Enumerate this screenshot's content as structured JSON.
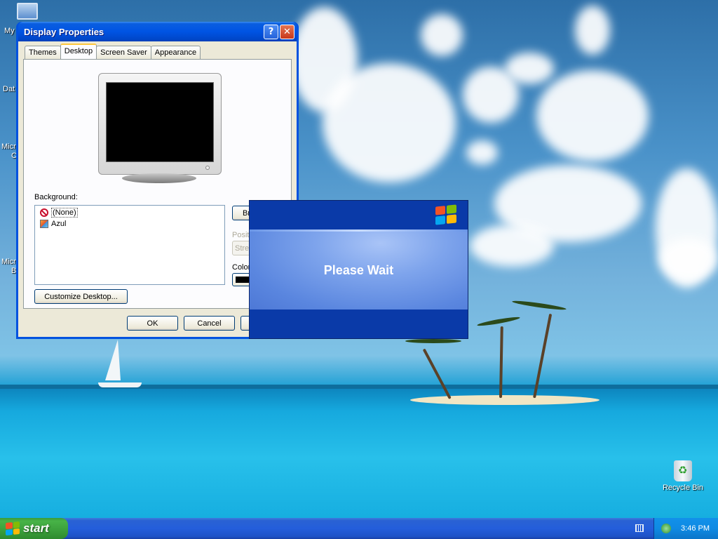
{
  "desktop": {
    "icons": [
      {
        "label": "My"
      },
      {
        "label": "Dat"
      },
      {
        "label": "Micro"
      },
      {
        "label": "C"
      },
      {
        "label": "Micro"
      },
      {
        "label": "B"
      }
    ],
    "recycle_bin": {
      "label": "Recycle Bin"
    }
  },
  "display_properties": {
    "title": "Display Properties",
    "help_glyph": "?",
    "close_glyph": "✕",
    "tabs": [
      {
        "label": "Themes"
      },
      {
        "label": "Desktop",
        "active": true
      },
      {
        "label": "Screen Saver"
      },
      {
        "label": "Appearance"
      }
    ],
    "background_label": "Background:",
    "backgrounds": [
      {
        "label": "(None)",
        "icon": "none-icon",
        "selected": true
      },
      {
        "label": "Azul",
        "icon": "image-file-icon"
      }
    ],
    "browse_label": "Br",
    "position_label": "Positi",
    "position_value": "Stret",
    "color_label": "Color:",
    "color_value": "#000000",
    "customize_label": "Customize Desktop...",
    "ok_label": "OK",
    "cancel_label": "Cancel"
  },
  "please_wait": {
    "message": "Please Wait"
  },
  "taskbar": {
    "start_label": "start",
    "clock": "3:46 PM"
  },
  "colors": {
    "xp_blue": "#0054e3",
    "start_green": "#3b9f3b",
    "tray_blue": "#0f8ae3",
    "flag_red": "#f35325",
    "flag_green": "#81bc06",
    "flag_blue": "#05a6f0",
    "flag_yellow": "#ffba08"
  }
}
